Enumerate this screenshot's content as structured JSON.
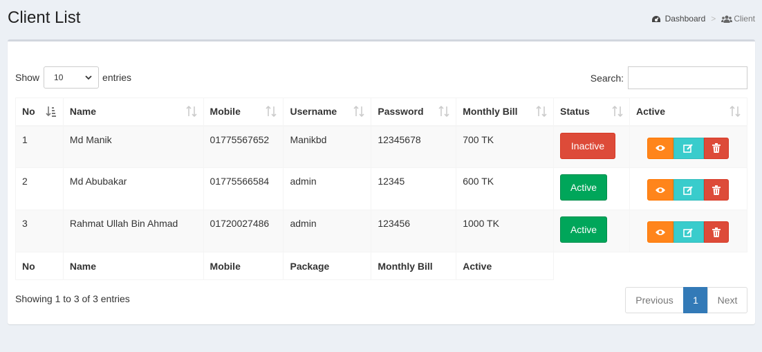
{
  "page": {
    "title": "Client List"
  },
  "breadcrumb": {
    "home": "Dashboard",
    "separator": ">",
    "current": "Client"
  },
  "length": {
    "prefix": "Show",
    "value": "10",
    "suffix": "entries"
  },
  "search": {
    "label": "Search:",
    "value": ""
  },
  "table": {
    "headers": [
      "No",
      "Name",
      "Mobile",
      "Username",
      "Password",
      "Monthly Bill",
      "Status",
      "Active"
    ],
    "rows": [
      {
        "no": "1",
        "name": "Md Manik",
        "mobile": "01775567652",
        "username": "Manikbd",
        "password": "12345678",
        "bill": "700 TK",
        "status": "Inactive"
      },
      {
        "no": "2",
        "name": "Md Abubakar",
        "mobile": "01775566584",
        "username": "admin",
        "password": "12345",
        "bill": "600 TK",
        "status": "Active"
      },
      {
        "no": "3",
        "name": "Rahmat Ullah Bin Ahmad",
        "mobile": "01720027486",
        "username": "admin",
        "password": "123456",
        "bill": "1000 TK",
        "status": "Active"
      }
    ],
    "footer": [
      "No",
      "Name",
      "Mobile",
      "Package",
      "Monthly Bill",
      "Active"
    ]
  },
  "info": "Showing 1 to 3 of 3 entries",
  "pagination": {
    "previous": "Previous",
    "current": "1",
    "next": "Next"
  },
  "colors": {
    "inactive": "#dd4b39",
    "active": "#00a65a",
    "view": "#ff851b",
    "edit": "#39cccc",
    "delete": "#dd4b39",
    "page_active": "#337ab7"
  },
  "icons": {
    "breadcrumb_home": "dashboard-icon",
    "breadcrumb_current": "users-icon",
    "view": "eye-icon",
    "edit": "edit-icon",
    "delete": "trash-icon",
    "sort": "sort-icon"
  }
}
